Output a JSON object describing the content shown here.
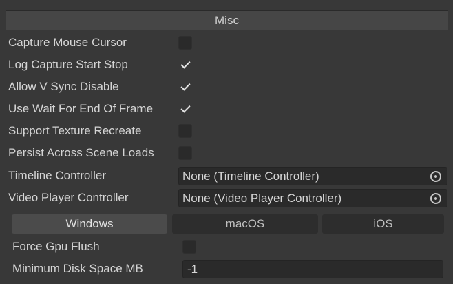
{
  "section": {
    "title": "Misc"
  },
  "settings": [
    {
      "label": "Capture Mouse Cursor",
      "checked": false
    },
    {
      "label": "Log Capture Start Stop",
      "checked": true
    },
    {
      "label": "Allow V Sync Disable",
      "checked": true
    },
    {
      "label": "Use Wait For End Of Frame",
      "checked": true
    },
    {
      "label": "Support Texture Recreate",
      "checked": false
    },
    {
      "label": "Persist Across Scene Loads",
      "checked": false
    }
  ],
  "timeline_controller": {
    "label": "Timeline Controller",
    "value": "None (Timeline Controller)",
    "icon": "object-picker-icon"
  },
  "video_player_controller": {
    "label": "Video Player Controller",
    "value": "None (Video Player Controller)",
    "icon": "object-picker-icon"
  },
  "platform_tabs": [
    {
      "label": "Windows",
      "active": true
    },
    {
      "label": "macOS",
      "active": false
    },
    {
      "label": "iOS",
      "active": false
    }
  ],
  "force_gpu_flush": {
    "label": "Force Gpu Flush",
    "checked": false
  },
  "minimum_disk_space": {
    "label": "Minimum Disk Space MB",
    "value": "-1"
  },
  "colors": {
    "background": "#383838",
    "header": "#464646",
    "field": "#2a2a2a",
    "active_tab": "#4b4b4b",
    "inactive_tab": "#2d2d2d",
    "text": "#d4d4d4"
  }
}
